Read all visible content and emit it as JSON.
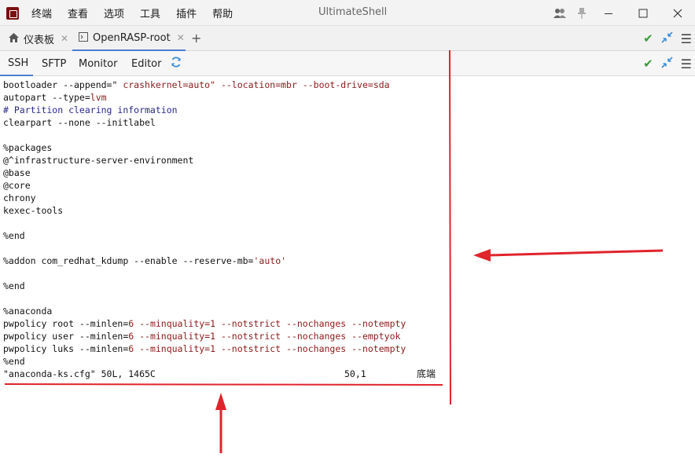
{
  "menu": [
    "终端",
    "查看",
    "选项",
    "工具",
    "插件",
    "帮助"
  ],
  "window_title": "UltimateShell",
  "tabs": [
    {
      "label": "仪表板",
      "icon": "home-icon"
    },
    {
      "label": "OpenRASP-root",
      "icon": "terminal-icon"
    }
  ],
  "subtabs": [
    "SSH",
    "SFTP",
    "Monitor",
    "Editor"
  ],
  "terminal": {
    "lines": [
      [
        {
          "t": "bootloader --append=\" "
        },
        {
          "t": "crashkernel=auto\" --location=mbr --boot-drive=sda",
          "c": "red"
        }
      ],
      [
        {
          "t": "autopart --type="
        },
        {
          "t": "lvm",
          "c": "red"
        }
      ],
      [
        {
          "t": "# Partition clearing information",
          "c": "blue"
        }
      ],
      [
        {
          "t": "clearpart --none --initlabel"
        }
      ],
      [
        {
          "t": ""
        }
      ],
      [
        {
          "t": "%packages"
        }
      ],
      [
        {
          "t": "@^infrastructure-server-environment"
        }
      ],
      [
        {
          "t": "@base"
        }
      ],
      [
        {
          "t": "@core"
        }
      ],
      [
        {
          "t": "chrony"
        }
      ],
      [
        {
          "t": "kexec-tools"
        }
      ],
      [
        {
          "t": ""
        }
      ],
      [
        {
          "t": "%end"
        }
      ],
      [
        {
          "t": ""
        }
      ],
      [
        {
          "t": "%addon com_redhat_kdump --enable --reserve-mb="
        },
        {
          "t": "'auto'",
          "c": "red"
        }
      ],
      [
        {
          "t": ""
        }
      ],
      [
        {
          "t": "%end"
        }
      ],
      [
        {
          "t": ""
        }
      ],
      [
        {
          "t": "%anaconda"
        }
      ],
      [
        {
          "t": "pwpolicy root --minlen="
        },
        {
          "t": "6 --minquality=1 --notstrict --nochanges --notempty",
          "c": "red"
        }
      ],
      [
        {
          "t": "pwpolicy user --minlen="
        },
        {
          "t": "6 --minquality=1 --notstrict --nochanges --emptyok",
          "c": "red"
        }
      ],
      [
        {
          "t": "pwpolicy luks --minlen="
        },
        {
          "t": "6 --minquality=1 --notstrict --nochanges --notempty",
          "c": "red"
        }
      ],
      [
        {
          "t": "%end"
        }
      ]
    ],
    "status_file": "\"anaconda-ks.cfg\" 50L, 1465C",
    "status_pos": "50,1",
    "status_where": "底端"
  },
  "annotation_color": "#e0242c"
}
